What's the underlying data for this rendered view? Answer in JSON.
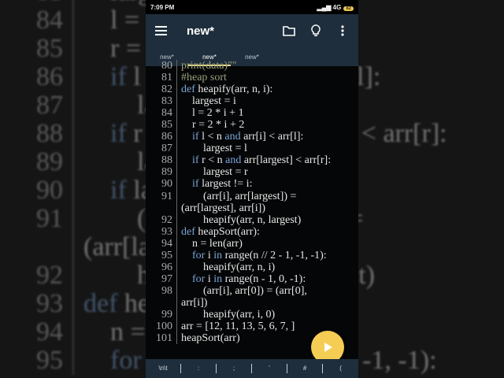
{
  "status": {
    "time": "7:09 PM",
    "network": "4G",
    "battery": "82"
  },
  "toolbar": {
    "title": "new*",
    "icons": [
      "menu-icon",
      "folder-icon",
      "lightbulb-icon",
      "more-vert-icon"
    ]
  },
  "tabs": [
    {
      "label": "new*",
      "active": false
    },
    {
      "label": "new*",
      "active": true
    },
    {
      "label": "new*",
      "active": false
    }
  ],
  "code": [
    {
      "n": "80",
      "t": [
        [
          "cm",
          "print(data)\"\""
        ]
      ]
    },
    {
      "n": "81",
      "t": [
        [
          "cm",
          "#heap sort"
        ]
      ]
    },
    {
      "n": "82",
      "t": [
        [
          "kw",
          "def"
        ],
        [
          "",
          "heapify(arr, n, i):"
        ]
      ]
    },
    {
      "n": "83",
      "t": [
        [
          "",
          "    largest = i"
        ]
      ]
    },
    {
      "n": "84",
      "t": [
        [
          "",
          "    l = 2 * i + 1"
        ]
      ]
    },
    {
      "n": "85",
      "t": [
        [
          "",
          "    r = 2 * i + 2"
        ]
      ]
    },
    {
      "n": "86",
      "t": [
        [
          "",
          "    "
        ],
        [
          "kw",
          "if"
        ],
        [
          "",
          "l < n "
        ],
        [
          "kw",
          "and"
        ],
        [
          "",
          "arr[i] < arr[l]:"
        ]
      ]
    },
    {
      "n": "87",
      "t": [
        [
          "",
          "        largest = l"
        ]
      ]
    },
    {
      "n": "88",
      "t": [
        [
          "",
          "    "
        ],
        [
          "kw",
          "if"
        ],
        [
          "",
          "r < n "
        ],
        [
          "kw",
          "and"
        ],
        [
          "",
          "arr[largest] < arr[r]:"
        ]
      ]
    },
    {
      "n": "89",
      "t": [
        [
          "",
          "        largest = r"
        ]
      ]
    },
    {
      "n": "90",
      "t": [
        [
          "",
          "    "
        ],
        [
          "kw",
          "if"
        ],
        [
          "",
          "largest != i:"
        ]
      ]
    },
    {
      "n": "91",
      "t": [
        [
          "",
          "        (arr[i], arr[largest]) ="
        ]
      ]
    },
    {
      "n": "",
      "t": [
        [
          "",
          "(arr[largest], arr[i])"
        ]
      ]
    },
    {
      "n": "92",
      "t": [
        [
          "",
          "        heapify(arr, n, largest)"
        ]
      ]
    },
    {
      "n": "93",
      "t": [
        [
          "kw",
          "def"
        ],
        [
          "",
          "heapSort(arr):"
        ]
      ]
    },
    {
      "n": "94",
      "t": [
        [
          "",
          "    n = len(arr)"
        ]
      ]
    },
    {
      "n": "95",
      "t": [
        [
          "",
          "    "
        ],
        [
          "kw",
          "for"
        ],
        [
          "",
          "i "
        ],
        [
          "kw",
          "in"
        ],
        [
          "",
          "range(n // 2 - 1, -1, -1):"
        ]
      ]
    },
    {
      "n": "96",
      "t": [
        [
          "",
          "        heapify(arr, n, i)"
        ]
      ]
    },
    {
      "n": "97",
      "t": [
        [
          "",
          "    "
        ],
        [
          "kw",
          "for"
        ],
        [
          "",
          "i "
        ],
        [
          "kw",
          "in"
        ],
        [
          "",
          "range(n - 1, 0, -1):"
        ]
      ]
    },
    {
      "n": "98",
      "t": [
        [
          "",
          "        (arr[i], arr[0]) = (arr[0],"
        ]
      ]
    },
    {
      "n": "",
      "t": [
        [
          "",
          "arr[i])"
        ]
      ]
    },
    {
      "n": "99",
      "t": [
        [
          "",
          "        heapify(arr, i, 0)"
        ]
      ]
    },
    {
      "n": "100",
      "t": [
        [
          "",
          "arr = [12, 11, 13, 5, 6, 7, ]"
        ]
      ]
    },
    {
      "n": "101",
      "t": [
        [
          "",
          "heapSort(arr)"
        ]
      ]
    }
  ],
  "keys": [
    "\\n\\t",
    ":",
    ";",
    "'",
    "#",
    "("
  ],
  "colors": {
    "toolbar": "#1e2e3c",
    "accent": "#f5cd55",
    "keyword": "#7aa4d8"
  }
}
